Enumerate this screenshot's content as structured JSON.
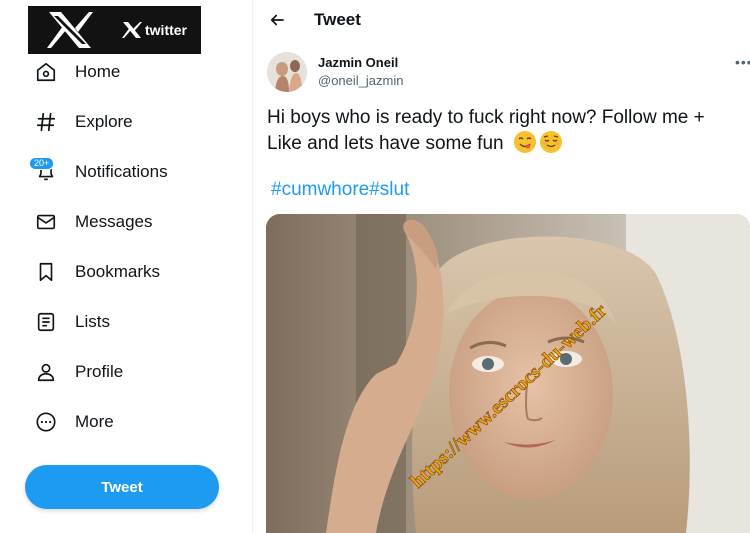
{
  "brand": {
    "small_label": "twitter"
  },
  "nav": {
    "items": [
      {
        "label": "Home",
        "icon": "home-icon"
      },
      {
        "label": "Explore",
        "icon": "hashtag-icon"
      },
      {
        "label": "Notifications",
        "icon": "bell-icon",
        "badge": "20+"
      },
      {
        "label": "Messages",
        "icon": "envelope-icon"
      },
      {
        "label": "Bookmarks",
        "icon": "bookmark-icon"
      },
      {
        "label": "Lists",
        "icon": "list-icon"
      },
      {
        "label": "Profile",
        "icon": "person-icon"
      },
      {
        "label": "More",
        "icon": "more-circle-icon"
      }
    ],
    "tweet_button_label": "Tweet"
  },
  "header": {
    "title": "Tweet"
  },
  "tweet": {
    "author_name": "Jazmin Oneil",
    "author_handle": "@oneil_jazmin",
    "text": "Hi boys who is ready to fuck right now? Follow me + Like and lets have some fun",
    "hashtags": [
      "#cumwhore",
      "#slut"
    ]
  },
  "watermark": {
    "text": "https://www.escrocs-du-web.fr",
    "color": "#f3a114"
  },
  "colors": {
    "accent": "#1d9bf0",
    "text": "#0f1419",
    "secondary": "#536471"
  }
}
